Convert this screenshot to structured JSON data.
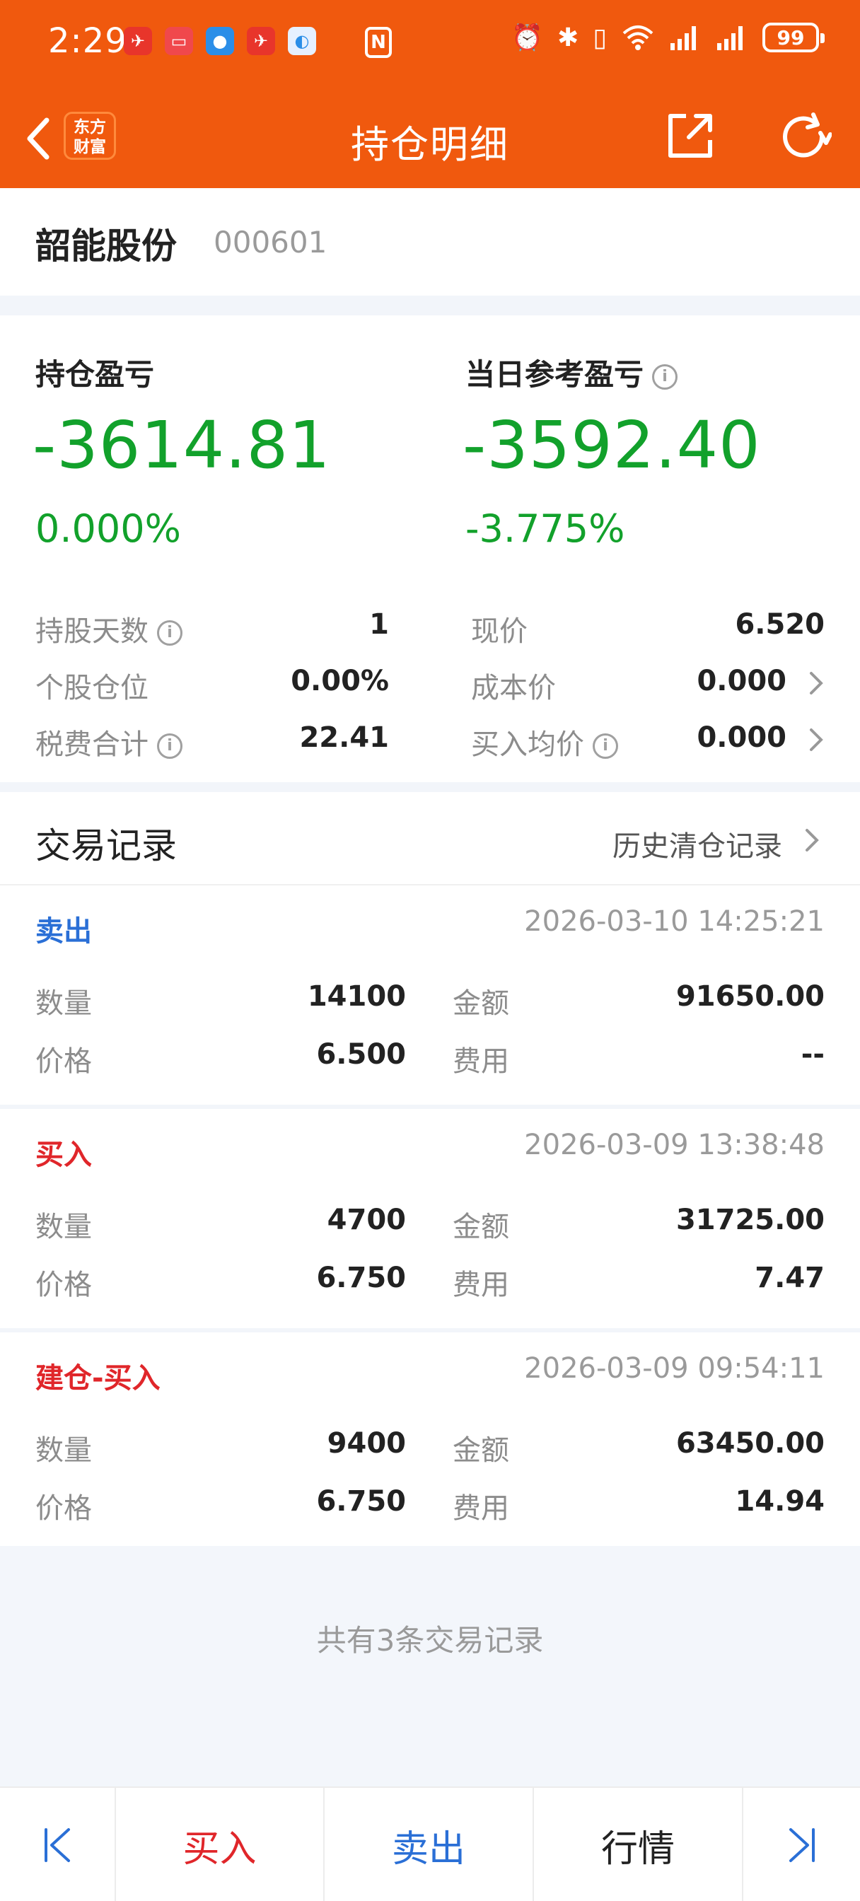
{
  "status_bar": {
    "time": "2:29",
    "battery": "99"
  },
  "nav": {
    "logo_line1": "东方",
    "logo_line2": "财富",
    "title": "持仓明细"
  },
  "stock": {
    "name": "韶能股份",
    "code": "000601"
  },
  "summary": {
    "position_pl_label": "持仓盈亏",
    "position_pl_value": "-3614.81",
    "position_pl_pct": "0.000%",
    "daily_pl_label": "当日参考盈亏",
    "daily_pl_value": "-3592.40",
    "daily_pl_pct": "-3.775%",
    "colors": {
      "loss": "#12a12b"
    },
    "rows": [
      {
        "left_label": "持股天数",
        "left_value": "1",
        "right_label": "现价",
        "right_value": "6.520"
      },
      {
        "left_label": "个股仓位",
        "left_value": "0.00%",
        "right_label": "成本价",
        "right_value": "0.000"
      },
      {
        "left_label": "税费合计",
        "left_value": "22.41",
        "right_label": "买入均价",
        "right_value": "0.000"
      }
    ]
  },
  "trades": {
    "title": "交易记录",
    "history_link": "历史清仓记录",
    "records": [
      {
        "type": "卖出",
        "type_color": "#2a6fd6",
        "time": "2026-03-10 14:25:21",
        "qty_label": "数量",
        "qty": "14100",
        "amount_label": "金额",
        "amount": "91650.00",
        "price_label": "价格",
        "price": "6.500",
        "fee_label": "费用",
        "fee": "--"
      },
      {
        "type": "买入",
        "type_color": "#e0262a",
        "time": "2026-03-09 13:38:48",
        "qty_label": "数量",
        "qty": "4700",
        "amount_label": "金额",
        "amount": "31725.00",
        "price_label": "价格",
        "price": "6.750",
        "fee_label": "费用",
        "fee": "7.47"
      },
      {
        "type": "建仓-买入",
        "type_color": "#e0262a",
        "time": "2026-03-09 09:54:11",
        "qty_label": "数量",
        "qty": "9400",
        "amount_label": "金额",
        "amount": "63450.00",
        "price_label": "价格",
        "price": "6.750",
        "fee_label": "费用",
        "fee": "14.94"
      }
    ],
    "total_text": "共有3条交易记录"
  },
  "bottom_bar": {
    "buy_label": "买入",
    "sell_label": "卖出",
    "quote_label": "行情",
    "colors": {
      "buy": "#e0262a",
      "sell": "#2a6fd6",
      "nav_icon": "#2a6fd6"
    }
  }
}
